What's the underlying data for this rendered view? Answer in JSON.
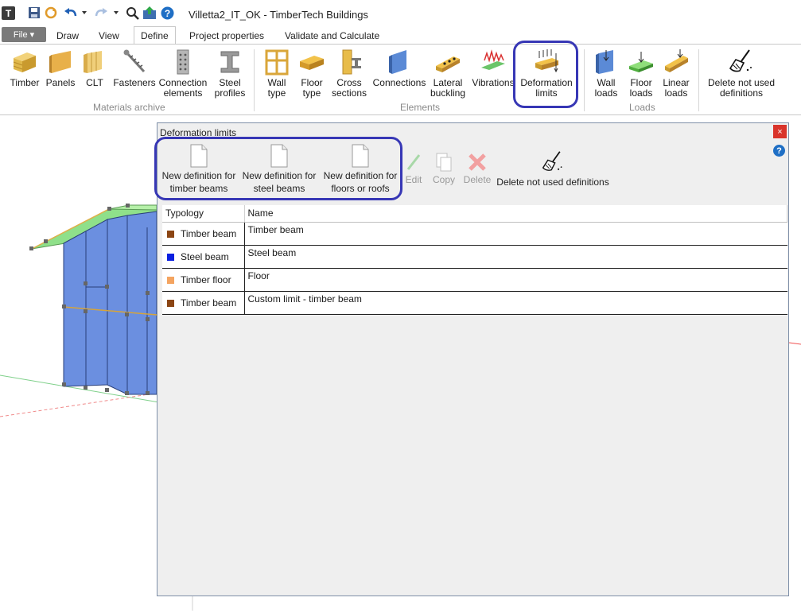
{
  "app": {
    "title": "Villetta2_IT_OK - TimberTech Buildings"
  },
  "quick_access": {
    "icons": [
      "app-logo-icon",
      "save-icon",
      "refresh-icon",
      "undo-icon",
      "dropdown-icon",
      "redo-icon",
      "dropdown-icon",
      "search-icon",
      "export-icon",
      "help-icon"
    ]
  },
  "tabs": {
    "file": "File ▾",
    "items": [
      "Draw",
      "View",
      "Define",
      "Project properties",
      "Validate and Calculate"
    ],
    "active": "Define"
  },
  "ribbon": {
    "materials": {
      "label": "Materials archive",
      "buttons": [
        "Timber",
        "Panels",
        "CLT",
        "Fasteners",
        "Connection\nelements",
        "Steel\nprofiles"
      ]
    },
    "elements": {
      "label": "Elements",
      "buttons": [
        "Wall\ntype",
        "Floor\ntype",
        "Cross\nsections",
        "Connections",
        "Lateral\nbuckling",
        "Vibrations",
        "Deformation\nlimits"
      ]
    },
    "loads": {
      "label": "Loads",
      "buttons": [
        "Wall\nloads",
        "Floor\nloads",
        "Linear\nloads"
      ]
    },
    "delete_unused": "Delete not used\ndefinitions"
  },
  "dialog": {
    "title": "Deformation limits",
    "close": "×",
    "help": "?",
    "toolbar": {
      "new_timber": "New definition for\ntimber beams",
      "new_steel": "New definition for\nsteel beams",
      "new_floor": "New definition for\nfloors or roofs",
      "edit": "Edit",
      "copy": "Copy",
      "delete": "Delete",
      "delete_unused": "Delete not used definitions"
    },
    "table": {
      "columns": [
        "Typology",
        "Name"
      ],
      "rows": [
        {
          "typology": "Timber beam",
          "name": "Timber beam",
          "color": "#8b4513"
        },
        {
          "typology": "Steel beam",
          "name": "Steel beam",
          "color": "#0a1fe0"
        },
        {
          "typology": "Timber floor",
          "name": "Floor",
          "color": "#f4a460"
        },
        {
          "typology": "Timber beam",
          "name": "Custom limit - timber beam",
          "color": "#8b4513"
        }
      ]
    }
  },
  "colors": {
    "highlight": "#3737b5",
    "wall_blue": "#6b8fe0",
    "roof_green": "#8fe08a"
  }
}
